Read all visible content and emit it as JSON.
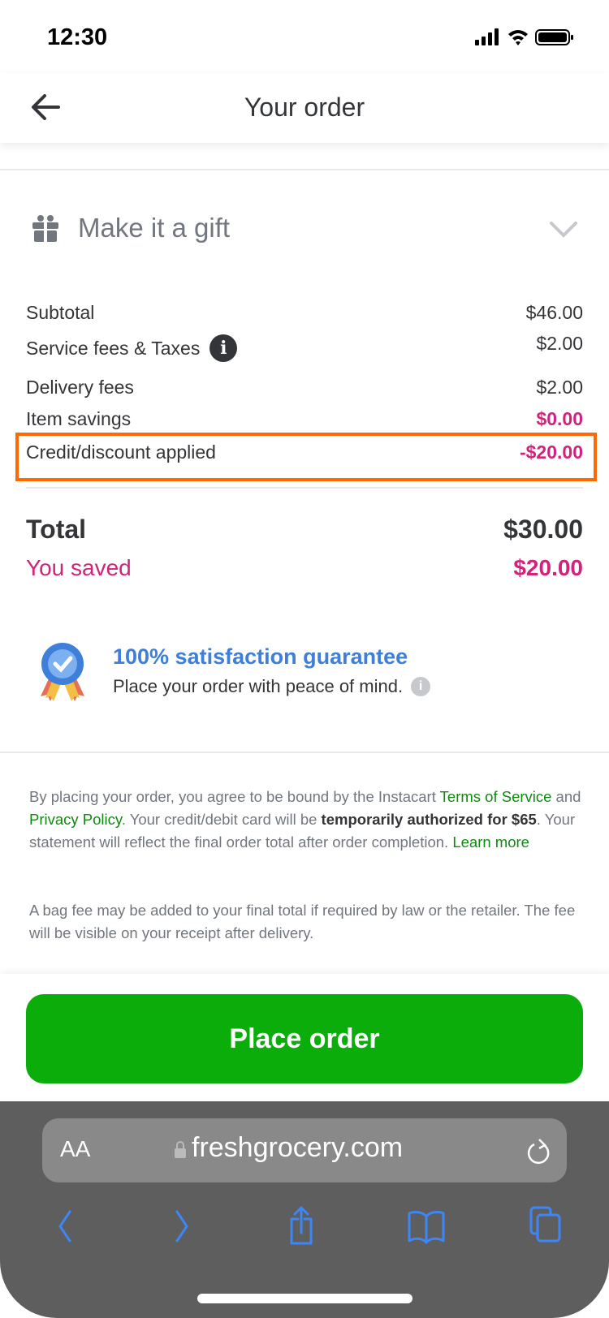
{
  "status_bar": {
    "time": "12:30"
  },
  "header": {
    "title": "Your order"
  },
  "gift": {
    "label": "Make it a gift"
  },
  "summary": [
    {
      "label": "Subtotal",
      "value": "$46.00"
    },
    {
      "label": "Service fees & Taxes",
      "value": "$2.00"
    },
    {
      "label": "Delivery fees",
      "value": "$2.00"
    },
    {
      "label": "Item savings",
      "value": "$0.00"
    },
    {
      "label": "Credit/discount applied",
      "value": "-$20.00"
    }
  ],
  "total": {
    "label": "Total",
    "value": "$30.00"
  },
  "saved": {
    "label": "You saved",
    "value": "$20.00"
  },
  "guarantee": {
    "title": "100% satisfaction guarantee",
    "subtitle": "Place your order with peace of mind."
  },
  "legal": {
    "p1": "By placing your order, you agree to be bound by the Instacart ",
    "terms": "Terms of Service",
    "and": " and ",
    "privacy": "Privacy Policy",
    "p2": ". Your credit/debit card will be ",
    "bold": "temporarily authorized for $65",
    "p3": ". Your statement will reflect the final order total after order completion. ",
    "learn": "Learn more",
    "bag": "A bag fee may be added to your final total if required by law or the retailer. The fee will be visible on your receipt after delivery."
  },
  "place_order": "Place order",
  "browser": {
    "aa": "AA",
    "url": "freshgrocery.com"
  },
  "colors": {
    "accent": "#0aad0a",
    "pink": "#d0247a",
    "highlight": "#ff6a00",
    "blue": "#3d7fd9"
  }
}
